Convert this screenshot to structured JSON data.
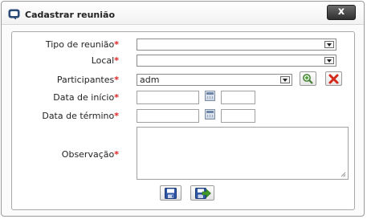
{
  "dialog": {
    "title": "Cadastrar reunião",
    "close_label": "x"
  },
  "form": {
    "required_marker": "*",
    "colon": ":",
    "meeting_type": {
      "label": "Tipo de reunião",
      "value": ""
    },
    "location": {
      "label": "Local",
      "value": ""
    },
    "participants": {
      "label": "Participantes",
      "value": "adm"
    },
    "start_date": {
      "label": "Data de início",
      "date": "",
      "time": ""
    },
    "end_date": {
      "label": "Data de término",
      "date": "",
      "time": ""
    },
    "notes": {
      "label": "Observação",
      "value": ""
    }
  },
  "icons": {
    "window": "dialog-window-icon",
    "add_participant": "add-participant-icon",
    "remove_participant": "remove-participant-icon",
    "calendar": "calendar-icon",
    "save": "save-icon",
    "save_and_go": "save-and-continue-icon"
  },
  "colors": {
    "required": "#e02020",
    "close_button": "#3a3a3a",
    "add_icon": "#3f9a2a",
    "remove_icon": "#d42a1c",
    "save_icon": "#2f56a5"
  }
}
